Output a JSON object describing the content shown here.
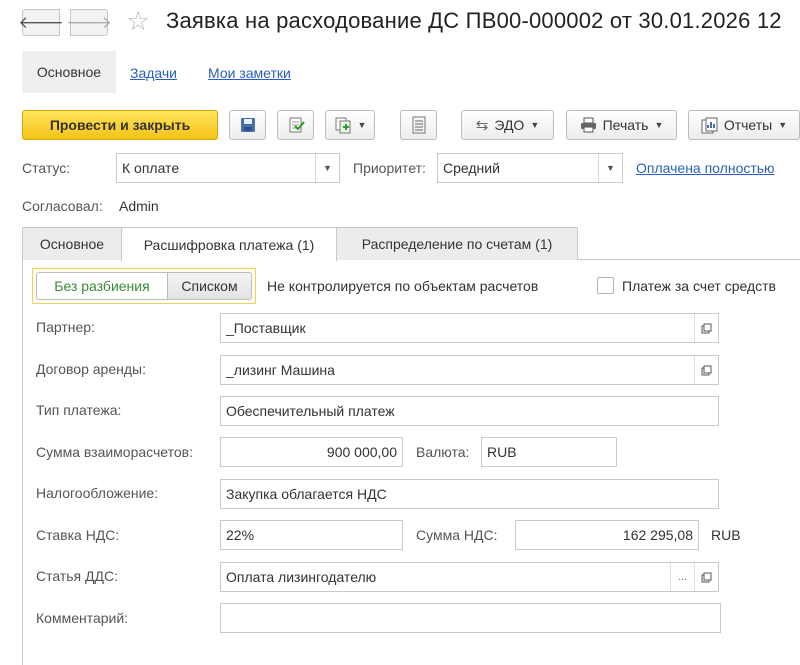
{
  "window": {
    "title": "Заявка на расходование ДС ПВ00-000002 от 30.01.2026 12"
  },
  "nav": {
    "back_glyph": "🡐",
    "forward_glyph": "🡒",
    "main": "Основное",
    "tasks": "Задачи",
    "notes": "Мои заметки"
  },
  "toolbar": {
    "post_close": "Провести и закрыть",
    "edo": "ЭДО",
    "print": "Печать",
    "reports": "Отчеты"
  },
  "header": {
    "status_label": "Статус:",
    "status_value": "К оплате",
    "priority_label": "Приоритет:",
    "priority_value": "Средний",
    "paid_link": "Оплачена полностью",
    "approved_label": "Согласовал:",
    "approved_value": "Admin"
  },
  "tabs": [
    {
      "label": "Основное"
    },
    {
      "label": "Расшифровка платежа (1)"
    },
    {
      "label": "Распределение по счетам (1)"
    }
  ],
  "split": {
    "no_split": "Без разбиения",
    "list": "Списком",
    "not_controlled": "Не контролируется по объектам расчетов",
    "payment_funds": "Платеж за счет средств"
  },
  "form": {
    "partner_label": "Партнер:",
    "partner_value": "_Поставщик",
    "lease_label": "Договор аренды:",
    "lease_value": "_лизинг Машина",
    "payment_type_label": "Тип платежа:",
    "payment_type_value": "Обеспечительный платеж",
    "amount_label": "Сумма взаиморасчетов:",
    "amount_value": "900 000,00",
    "currency_label": "Валюта:",
    "currency_value": "RUB",
    "tax_label": "Налогообложение:",
    "tax_value": "Закупка облагается НДС",
    "vat_rate_label": "Ставка НДС:",
    "vat_rate_value": "22%",
    "vat_sum_label": "Сумма НДС:",
    "vat_sum_value": "162 295,08",
    "vat_currency": "RUB",
    "dds_label": "Статья ДДС:",
    "dds_value": "Оплата лизингодателю",
    "dds_dots": "...",
    "comment_label": "Комментарий:",
    "comment_value": ""
  },
  "colors": {
    "accent_yellow": "#f4c318",
    "link_blue": "#2a5fbf",
    "active_green": "#3a8a3a"
  }
}
